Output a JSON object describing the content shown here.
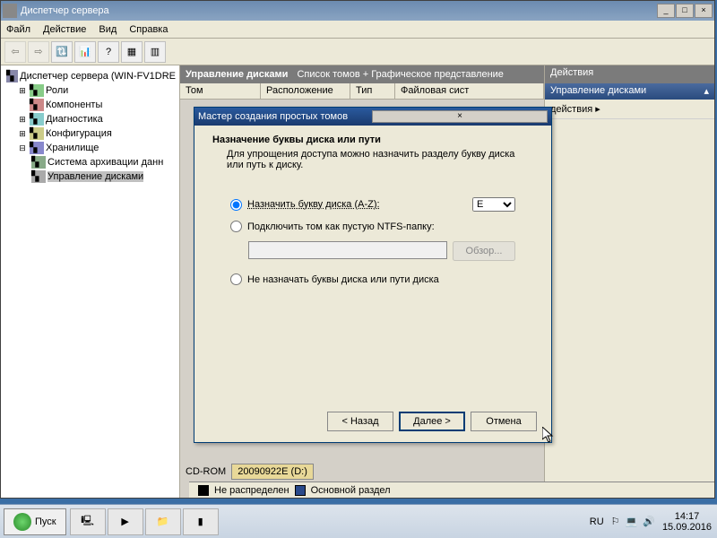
{
  "window": {
    "title": "Диспетчер сервера"
  },
  "menu": {
    "file": "Файл",
    "action": "Действие",
    "view": "Вид",
    "help": "Справка"
  },
  "tree": {
    "root": "Диспетчер сервера (WIN-FV1DRE",
    "roles": "Роли",
    "components": "Компоненты",
    "diagnostics": "Диагностика",
    "config": "Конфигурация",
    "storage": "Хранилище",
    "backup": "Система архивации данн",
    "diskmgmt": "Управление дисками"
  },
  "mid": {
    "title": "Управление дисками",
    "subtitle": "Список томов + Графическое представление",
    "col_volume": "Том",
    "col_layout": "Расположение",
    "col_type": "Тип",
    "col_fs": "Файловая сист",
    "cdrom": "CD-ROM",
    "cdlabel": "20090922E (D:)"
  },
  "right": {
    "header": "Действия",
    "sub": "Управление дисками",
    "item1": "действия"
  },
  "wizard": {
    "title": "Мастер создания простых томов",
    "heading": "Назначение буквы диска или пути",
    "desc": "Для упрощения доступа можно назначить разделу букву диска или путь к диску.",
    "opt1": "Назначить букву диска (A-Z):",
    "drive": "E",
    "opt2": "Подключить том как пустую NTFS-папку:",
    "browse": "Обзор...",
    "opt3": "Не назначать буквы диска или пути диска",
    "back": "< Назад",
    "next": "Далее >",
    "cancel": "Отмена"
  },
  "legend": {
    "unalloc": "Не распределен",
    "primary": "Основной раздел"
  },
  "taskbar": {
    "start": "Пуск",
    "lang": "RU",
    "time": "14:17",
    "date": "15.09.2016"
  }
}
